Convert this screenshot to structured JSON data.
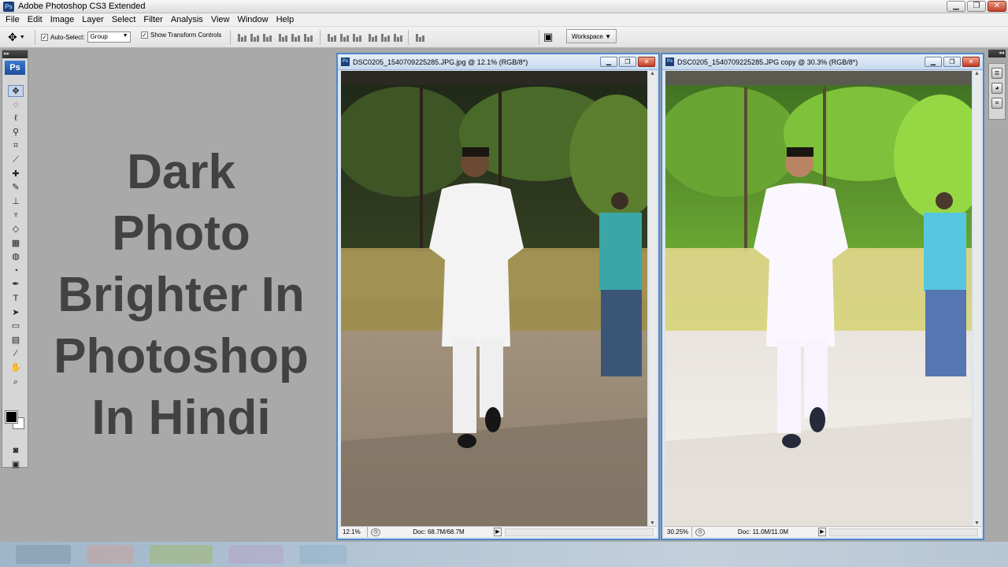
{
  "app": {
    "title": "Adobe Photoshop CS3 Extended",
    "icon": "Ps",
    "window_buttons": {
      "minimize": "▁",
      "maximize": "❐",
      "close": "✕"
    }
  },
  "menu": [
    "File",
    "Edit",
    "Image",
    "Layer",
    "Select",
    "Filter",
    "Analysis",
    "View",
    "Window",
    "Help"
  ],
  "options": {
    "auto_select_label": "Auto-Select:",
    "auto_select_value": "Group",
    "show_transform_label": "Show Transform Controls",
    "workspace_label": "Workspace ▼"
  },
  "tools": {
    "logo": "Ps",
    "grip": "▸▸",
    "items": [
      {
        "name": "move-tool-icon",
        "glyph": "✥",
        "active": true
      },
      {
        "name": "marquee-tool-icon",
        "glyph": "◌"
      },
      {
        "name": "lasso-tool-icon",
        "glyph": "ℓ"
      },
      {
        "name": "magic-wand-tool-icon",
        "glyph": "⚲"
      },
      {
        "name": "crop-tool-icon",
        "glyph": "⌗"
      },
      {
        "name": "slice-tool-icon",
        "glyph": "⟋"
      },
      {
        "name": "healing-brush-tool-icon",
        "glyph": "✚"
      },
      {
        "name": "brush-tool-icon",
        "glyph": "✎"
      },
      {
        "name": "clone-stamp-tool-icon",
        "glyph": "⊥"
      },
      {
        "name": "history-brush-tool-icon",
        "glyph": "♆"
      },
      {
        "name": "eraser-tool-icon",
        "glyph": "◇"
      },
      {
        "name": "gradient-tool-icon",
        "glyph": "▦"
      },
      {
        "name": "blur-tool-icon",
        "glyph": "◍"
      },
      {
        "name": "dodge-tool-icon",
        "glyph": "◔"
      },
      {
        "name": "pen-tool-icon",
        "glyph": "✒"
      },
      {
        "name": "type-tool-icon",
        "glyph": "T"
      },
      {
        "name": "path-selection-tool-icon",
        "glyph": "➤"
      },
      {
        "name": "shape-tool-icon",
        "glyph": "▭"
      },
      {
        "name": "notes-tool-icon",
        "glyph": "▤"
      },
      {
        "name": "eyedropper-tool-icon",
        "glyph": "⁄"
      },
      {
        "name": "hand-tool-icon",
        "glyph": "✋"
      },
      {
        "name": "zoom-tool-icon",
        "glyph": "⌕"
      },
      {
        "name": "quick-mask-icon",
        "glyph": "◙"
      },
      {
        "name": "screen-mode-icon",
        "glyph": "▣"
      }
    ]
  },
  "headline": [
    "Dark",
    "Photo",
    "Brighter In",
    "Photoshop",
    "In Hindi"
  ],
  "documents": [
    {
      "title": "DSC0205_1540709225285.JPG.jpg @ 12.1% (RGB/8*)",
      "zoom": "12.1%",
      "doc_size": "Doc: 68.7M/68.7M",
      "variant": "dark"
    },
    {
      "title": "DSC0205_1540709225285.JPG copy @ 30.3% (RGB/8*)",
      "zoom": "30.25%",
      "doc_size": "Doc: 11.0M/11.0M",
      "variant": "bright"
    }
  ],
  "colors": {
    "accent": "#4f88c9",
    "workspace_bg": "#a9a9a9",
    "headline": "#424242"
  }
}
